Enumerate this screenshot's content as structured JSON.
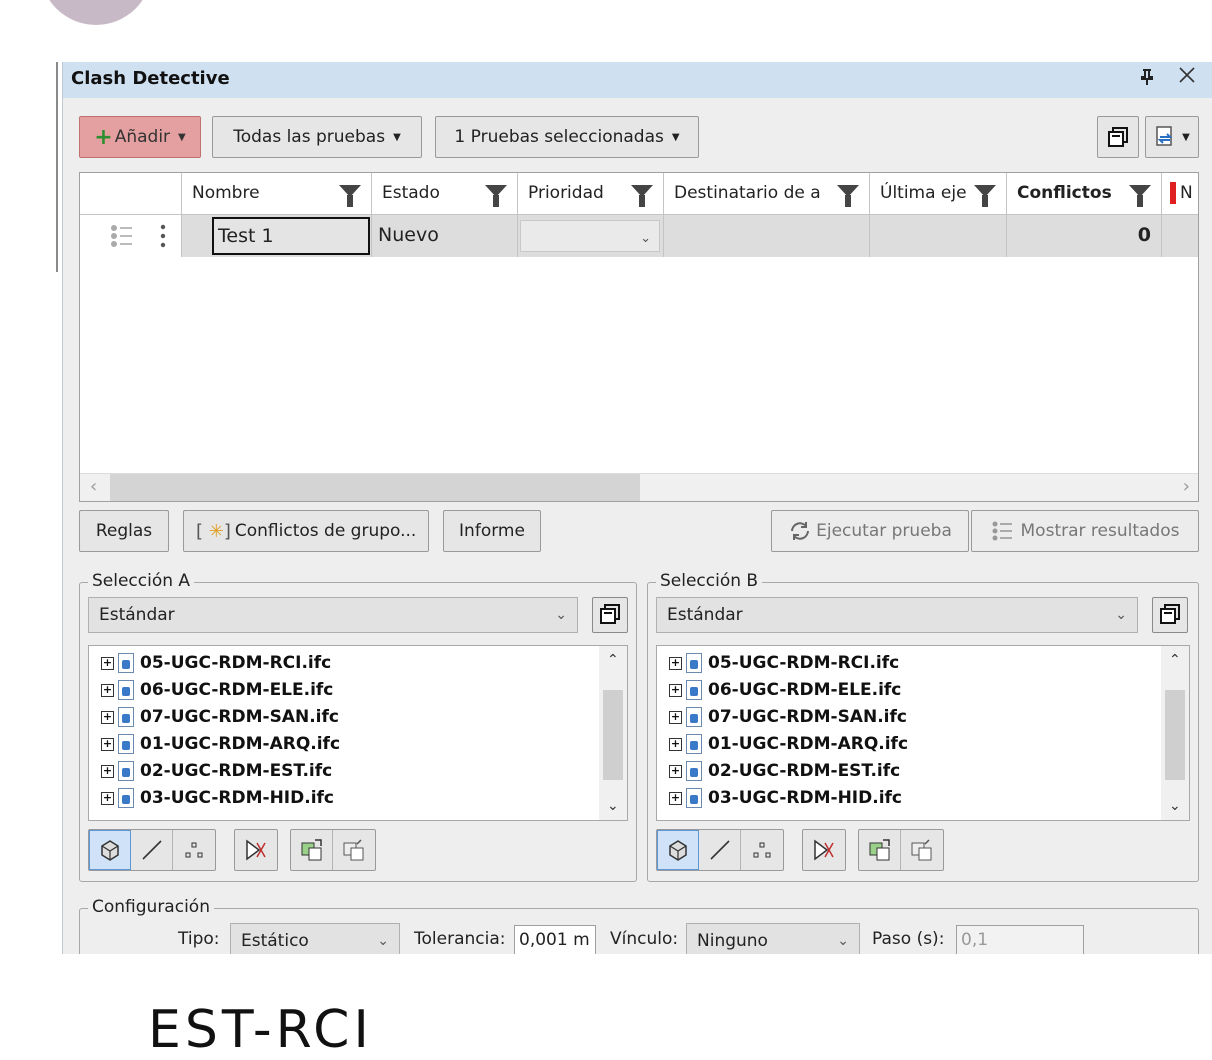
{
  "window": {
    "title": "Clash Detective",
    "pin_glyph": "⊥",
    "close_glyph": "✕"
  },
  "toolbar": {
    "add_label": "Añadir",
    "all_tests_label": "Todas las pruebas",
    "selected_tests_label": "1 Pruebas seleccionadas"
  },
  "grid": {
    "columns": [
      "Nombre",
      "Estado",
      "Prioridad",
      "Destinatario de a",
      "Última eje",
      "Conflictos",
      "N"
    ],
    "rows": [
      {
        "name": "Test 1",
        "status": "Nuevo",
        "priority": "",
        "assignee": "",
        "last_run": "",
        "conflicts": "0"
      }
    ]
  },
  "actions": {
    "rules_label": "Reglas",
    "group_conflicts_label": "Conflictos de grupo...",
    "report_label": "Informe",
    "run_test_label": "Ejecutar prueba",
    "show_results_label": "Mostrar resultados"
  },
  "selection_a": {
    "legend": "Selección A",
    "mode": "Estándar",
    "files": [
      "05-UGC-RDM-RCI.ifc",
      "06-UGC-RDM-ELE.ifc",
      "07-UGC-RDM-SAN.ifc",
      "01-UGC-RDM-ARQ.ifc",
      "02-UGC-RDM-EST.ifc",
      "03-UGC-RDM-HID.ifc"
    ]
  },
  "selection_b": {
    "legend": "Selección B",
    "mode": "Estándar",
    "files": [
      "05-UGC-RDM-RCI.ifc",
      "06-UGC-RDM-ELE.ifc",
      "07-UGC-RDM-SAN.ifc",
      "01-UGC-RDM-ARQ.ifc",
      "02-UGC-RDM-EST.ifc",
      "03-UGC-RDM-HID.ifc"
    ]
  },
  "config": {
    "legend": "Configuración",
    "type_label": "Tipo:",
    "type_value": "Estático",
    "tolerance_label": "Tolerancia:",
    "tolerance_value": "0,001 m",
    "link_label": "Vínculo:",
    "link_value": "Ninguno",
    "step_label": "Paso (s):",
    "step_value": "0,1"
  },
  "footer_text": "EST-RCI",
  "colors": {
    "accent_add": "#e4a0a0",
    "titlebar": "#cfe0f1",
    "conflict_marker": "#e02020"
  }
}
